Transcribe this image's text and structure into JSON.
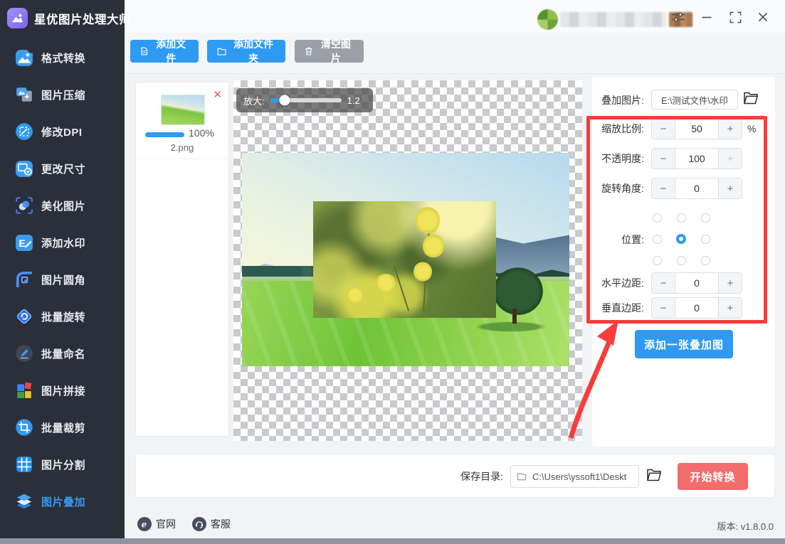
{
  "app": {
    "title": "星优图片处理大师",
    "version": "版本: v1.8.0.0"
  },
  "titlebar": {
    "user_account": "redacted-blurred",
    "icons": [
      "settings-sliders-icon",
      "minimize-icon",
      "maximize-icon",
      "close-icon"
    ]
  },
  "sidebar": {
    "items": [
      {
        "label": "格式转换",
        "icon": "image-convert-icon",
        "active": false
      },
      {
        "label": "图片压缩",
        "icon": "image-compress-icon",
        "active": false
      },
      {
        "label": "修改DPI",
        "icon": "dpi-icon",
        "active": false
      },
      {
        "label": "更改尺寸",
        "icon": "resize-icon",
        "active": false
      },
      {
        "label": "美化图片",
        "icon": "beautify-icon",
        "active": false
      },
      {
        "label": "添加水印",
        "icon": "watermark-icon",
        "active": false
      },
      {
        "label": "图片圆角",
        "icon": "rounded-corner-icon",
        "active": false
      },
      {
        "label": "批量旋转",
        "icon": "rotate-icon",
        "active": false
      },
      {
        "label": "批量命名",
        "icon": "rename-icon",
        "active": false
      },
      {
        "label": "图片拼接",
        "icon": "puzzle-icon",
        "active": false
      },
      {
        "label": "批量裁剪",
        "icon": "crop-icon",
        "active": false
      },
      {
        "label": "图片分割",
        "icon": "split-icon",
        "active": false
      },
      {
        "label": "图片叠加",
        "icon": "layers-icon",
        "active": true
      }
    ]
  },
  "toolbar": {
    "add_file": "添加文件",
    "add_folder": "添加文件夹",
    "clear": "清空图片"
  },
  "file_list": {
    "thumb": {
      "name": "2.png",
      "progress": "100%",
      "remove": "✕"
    }
  },
  "canvas": {
    "zoom_label": "放大:",
    "zoom_value": "1.2",
    "zoom_fill_percent": 20
  },
  "settings": {
    "overlay_label": "叠加图片:",
    "overlay_path": "E:\\测试文件\\水印",
    "minus": "−",
    "plus": "+",
    "rows": [
      {
        "label": "缩放比例:",
        "value": "50",
        "suffix": "%",
        "plus_disabled": false
      },
      {
        "label": "不透明度:",
        "value": "100",
        "suffix": "",
        "plus_disabled": true
      },
      {
        "label": "旋转角度:",
        "value": "0",
        "suffix": "",
        "plus_disabled": false
      }
    ],
    "position_label": "位置:",
    "position_selected_index": 4,
    "margin_rows": [
      {
        "label": "水平边距:",
        "value": "0"
      },
      {
        "label": "垂直边距:",
        "value": "0"
      }
    ],
    "add_overlay_button": "添加一张叠加图"
  },
  "save_bar": {
    "label": "保存目录:",
    "path": "C:\\Users\\yssoft1\\Deskt",
    "start_button": "开始转换"
  },
  "footer": {
    "website": "官网",
    "support": "客服",
    "version": "版本: v1.8.0.0"
  },
  "colors": {
    "accent_blue": "#2e9af2",
    "sidebar_bg": "#2b2f3a",
    "sidebar_active_text": "#3898f0",
    "danger_red": "#f56c6c",
    "annotation_red": "#fa3c3c",
    "gray_button": "#9b9fa8",
    "progress_blue": "#2e9af2"
  }
}
